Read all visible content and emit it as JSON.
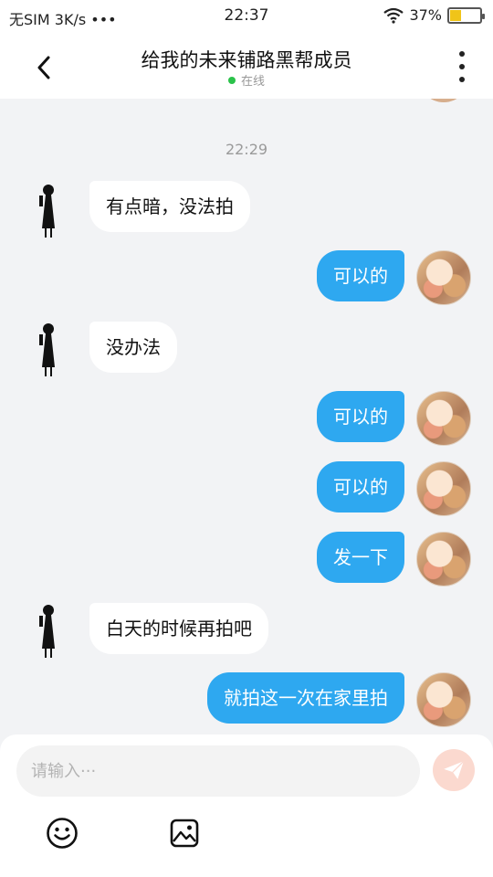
{
  "status_bar": {
    "carrier": "无SIM 3K/s •••",
    "time": "22:37",
    "battery_percent": "37%",
    "battery_level": 0.37,
    "icons": [
      "wifi-icon",
      "battery-icon"
    ]
  },
  "header": {
    "title": "给我的未来铺路黑帮成员",
    "status": "在线",
    "status_color": "#2bc24a",
    "icons": [
      "back-arrow-icon",
      "more-vertical-icon"
    ]
  },
  "chat": {
    "timestamp": "22:29",
    "messages": [
      {
        "side": "left",
        "text": "有点暗，没法拍"
      },
      {
        "side": "right",
        "text": "可以的"
      },
      {
        "side": "left",
        "text": "没办法"
      },
      {
        "side": "right",
        "text": "可以的"
      },
      {
        "side": "right",
        "text": "可以的"
      },
      {
        "side": "right",
        "text": "发一下"
      },
      {
        "side": "left",
        "text": "白天的时候再拍吧"
      },
      {
        "side": "right",
        "text": "就拍这一次在家里拍"
      }
    ]
  },
  "input": {
    "placeholder": "请输入···",
    "value": "",
    "icons": [
      "send-icon",
      "emoji-icon",
      "image-icon"
    ]
  },
  "colors": {
    "accent": "#2ea8f0",
    "background": "#f2f3f5",
    "send_button": "#fbd9cf"
  }
}
